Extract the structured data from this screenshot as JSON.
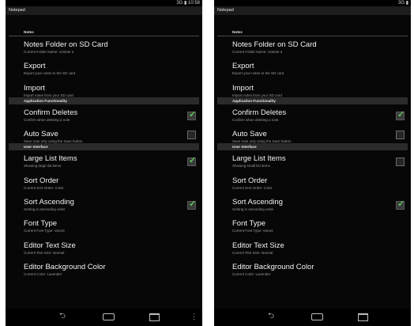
{
  "left": {
    "status": {
      "signal_label": "3G",
      "time": "10:58"
    },
    "app_title": "Notepad",
    "categories": {
      "notes": "Notes",
      "app_func": "Application Functionality",
      "user_interface": "User Interface"
    },
    "prefs": {
      "notes_folder": {
        "title": "Notes Folder on SD Card",
        "summary": "Current Folder Name: 12stote a"
      },
      "export": {
        "title": "Export",
        "summary": "Export your notes to the SD card"
      },
      "import": {
        "title": "Import",
        "summary": "Import notes from your SD card"
      },
      "confirm_deletes": {
        "title": "Confirm Deletes",
        "summary": "Confirm when deleting a note",
        "checked": true
      },
      "auto_save": {
        "title": "Auto Save",
        "summary": "Save note only using the Save button",
        "checked": false
      },
      "large_list": {
        "title": "Large List Items",
        "summary": "Showing large list items",
        "checked": true
      },
      "sort_order": {
        "title": "Sort Order",
        "summary": "Current Sort Order: Color"
      },
      "sort_ascending": {
        "title": "Sort Ascending",
        "summary": "Sorting in ascending order",
        "checked": true
      },
      "font_type": {
        "title": "Font Type",
        "summary": "Current Font Type: Varont"
      },
      "editor_size": {
        "title": "Editor Text Size",
        "summary": "Current Text Size: Normal"
      },
      "editor_bg": {
        "title": "Editor Background Color",
        "summary": "Current Color: Lavender"
      }
    },
    "nav": {
      "back": "⮌",
      "more": "⋮"
    }
  },
  "right": {
    "status": {
      "signal_label": "3G"
    },
    "app_title": "Notepad",
    "categories": {
      "notes": "Notes",
      "app_func": "Application Functionality",
      "user_interface": "User Interface"
    },
    "prefs": {
      "notes_folder": {
        "title": "Notes Folder on SD Card",
        "summary": "Current Folder Name: 12stote a"
      },
      "export": {
        "title": "Export",
        "summary": "Export your notes to the SD card"
      },
      "import": {
        "title": "Import",
        "summary": "Import notes from your SD card"
      },
      "confirm_deletes": {
        "title": "Confirm Deletes",
        "summary": "Confirm when deleting a note",
        "checked": true
      },
      "auto_save": {
        "title": "Auto Save",
        "summary": "Save note only using the Save button",
        "checked": false
      },
      "large_list": {
        "title": "Large List Items",
        "summary": "Showing small list items",
        "checked": false
      },
      "sort_order": {
        "title": "Sort Order",
        "summary": "Current Sort Order: Color"
      },
      "sort_ascending": {
        "title": "Sort Ascending",
        "summary": "Sorting in ascending order",
        "checked": true
      },
      "font_type": {
        "title": "Font Type",
        "summary": "Current Font Type: Varont"
      },
      "editor_size": {
        "title": "Editor Text Size",
        "summary": "Current Text Size: Normal"
      },
      "editor_bg": {
        "title": "Editor Background Color",
        "summary": "Current Color: Lavender"
      }
    },
    "nav": {
      "back": "⮌"
    }
  },
  "colors": {
    "checkmark": "#5ac85a",
    "background": "#070707",
    "category_bar": "#2b2b2b"
  },
  "icons": [
    "back-icon",
    "home-icon",
    "recent-apps-icon",
    "overflow-menu-icon",
    "checkbox-icon"
  ]
}
